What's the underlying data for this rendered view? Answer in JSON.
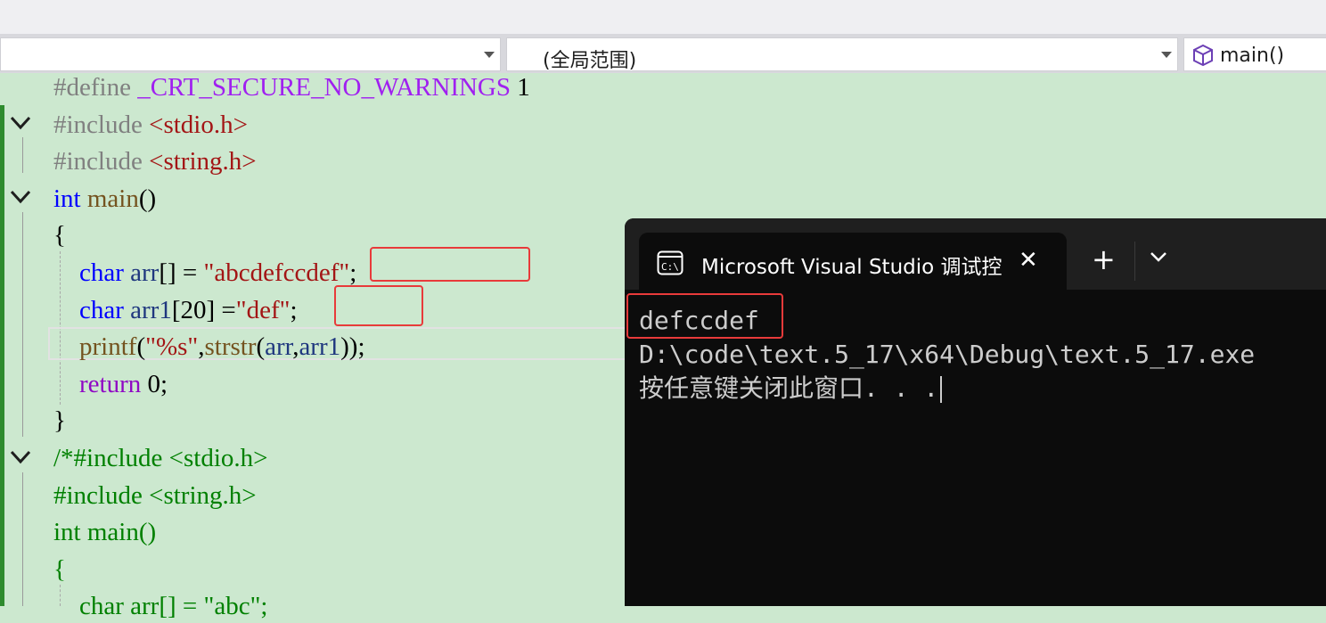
{
  "navbar": {
    "scope_label": "(全局范围)",
    "function_label": "main()"
  },
  "code_lines": [
    [
      {
        "c": "pp",
        "t": "#define "
      },
      {
        "c": "mac",
        "t": "_CRT_SECURE_NO_WARNINGS"
      },
      {
        "c": "num",
        "t": " 1"
      }
    ],
    [
      {
        "c": "pp",
        "t": "#include "
      },
      {
        "c": "inc",
        "t": "<stdio.h>"
      }
    ],
    [
      {
        "c": "pp",
        "t": "#include "
      },
      {
        "c": "inc",
        "t": "<string.h>"
      }
    ],
    [
      {
        "c": "kw",
        "t": "int"
      },
      {
        "c": "pl",
        "t": " "
      },
      {
        "c": "fn",
        "t": "main"
      },
      {
        "c": "pl",
        "t": "()"
      }
    ],
    [
      {
        "c": "pl",
        "t": "{"
      }
    ],
    [
      {
        "c": "pl",
        "t": "    "
      },
      {
        "c": "kw",
        "t": "char"
      },
      {
        "c": "pl",
        "t": " "
      },
      {
        "c": "var",
        "t": "arr"
      },
      {
        "c": "pl",
        "t": "[] = "
      },
      {
        "c": "str",
        "t": "\"abcdefccdef\""
      },
      {
        "c": "pl",
        "t": ";"
      }
    ],
    [
      {
        "c": "pl",
        "t": "    "
      },
      {
        "c": "kw",
        "t": "char"
      },
      {
        "c": "pl",
        "t": " "
      },
      {
        "c": "var",
        "t": "arr1"
      },
      {
        "c": "pl",
        "t": "[20] ="
      },
      {
        "c": "str",
        "t": "\"def\""
      },
      {
        "c": "pl",
        "t": ";"
      }
    ],
    [
      {
        "c": "pl",
        "t": "    "
      },
      {
        "c": "fn",
        "t": "printf"
      },
      {
        "c": "pl",
        "t": "("
      },
      {
        "c": "str",
        "t": "\"%s\""
      },
      {
        "c": "pl",
        "t": ","
      },
      {
        "c": "fn",
        "t": "strstr"
      },
      {
        "c": "pl",
        "t": "("
      },
      {
        "c": "var",
        "t": "arr"
      },
      {
        "c": "pl",
        "t": ","
      },
      {
        "c": "var",
        "t": "arr1"
      },
      {
        "c": "pl",
        "t": "));"
      }
    ],
    [
      {
        "c": "pl",
        "t": "    "
      },
      {
        "c": "ctrl",
        "t": "return"
      },
      {
        "c": "pl",
        "t": " 0;"
      }
    ],
    [
      {
        "c": "pl",
        "t": "}"
      }
    ],
    [
      {
        "c": "cm",
        "t": "/*#include <stdio.h>"
      }
    ],
    [
      {
        "c": "cm",
        "t": "#include <string.h>"
      }
    ],
    [
      {
        "c": "cm",
        "t": "int main()"
      }
    ],
    [
      {
        "c": "cm",
        "t": "{"
      }
    ],
    [
      {
        "c": "cm",
        "t": "    char arr[] = \"abc\";"
      }
    ]
  ],
  "terminal": {
    "tab_title": "Microsoft Visual Studio 调试控",
    "output_lines": [
      "defccdef",
      "D:\\code\\text.5_17\\x64\\Debug\\text.5_17.exe",
      "按任意键关闭此窗口. . ."
    ]
  }
}
